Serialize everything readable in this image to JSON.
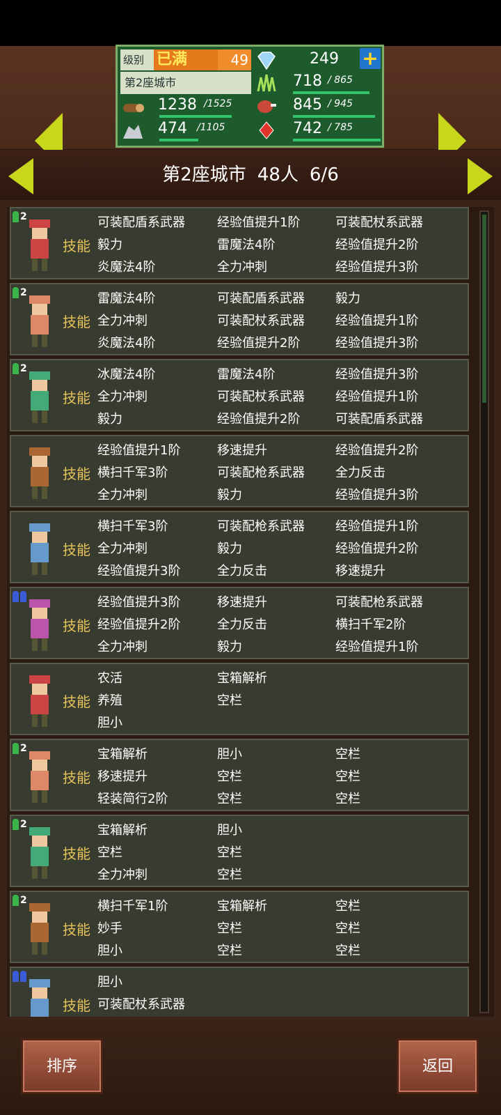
{
  "header": {
    "level_label": "级别",
    "level_max": "已满",
    "level_value": "49",
    "city": "第2座城市",
    "gems": "249",
    "resources": [
      {
        "name": "grass-icon",
        "value": "718",
        "max": "/ 865",
        "fill": 0.83
      },
      {
        "name": "wood-icon",
        "value": "1238",
        "max": "/1525",
        "fill": 0.81
      },
      {
        "name": "meat-icon",
        "value": "845",
        "max": "/ 945",
        "fill": 0.89
      },
      {
        "name": "ore-icon",
        "value": "474",
        "max": "/1105",
        "fill": 0.43
      },
      {
        "name": "ruby-icon",
        "value": "742",
        "max": "/ 785",
        "fill": 0.95
      }
    ]
  },
  "subheader": {
    "city": "第2座城市",
    "count": "48人",
    "ratio": "6/6"
  },
  "skill_label": "技能",
  "characters": [
    {
      "badge": "2",
      "team": "green",
      "skills": [
        "可装配盾系武器",
        "经验值提升1阶",
        "可装配杖系武器",
        "毅力",
        "雷魔法4阶",
        "经验值提升2阶",
        "炎魔法4阶",
        "全力冲刺",
        "经验值提升3阶"
      ]
    },
    {
      "badge": "2",
      "team": "green",
      "skills": [
        "雷魔法4阶",
        "可装配盾系武器",
        "毅力",
        "全力冲刺",
        "可装配杖系武器",
        "经验值提升1阶",
        "炎魔法4阶",
        "经验值提升2阶",
        "经验值提升3阶"
      ]
    },
    {
      "badge": "2",
      "team": "green",
      "skills": [
        "冰魔法4阶",
        "雷魔法4阶",
        "经验值提升3阶",
        "全力冲刺",
        "可装配杖系武器",
        "经验值提升1阶",
        "毅力",
        "经验值提升2阶",
        "可装配盾系武器"
      ]
    },
    {
      "badge": "",
      "team": "none",
      "skills": [
        "经验值提升1阶",
        "移速提升",
        "经验值提升2阶",
        "横扫千军3阶",
        "可装配枪系武器",
        "全力反击",
        "全力冲刺",
        "毅力",
        "经验值提升3阶"
      ]
    },
    {
      "badge": "",
      "team": "none",
      "skills": [
        "横扫千军3阶",
        "可装配枪系武器",
        "经验值提升1阶",
        "全力冲刺",
        "毅力",
        "经验值提升2阶",
        "经验值提升3阶",
        "全力反击",
        "移速提升"
      ]
    },
    {
      "badge": "",
      "team": "blue",
      "skills": [
        "经验值提升3阶",
        "移速提升",
        "可装配枪系武器",
        "经验值提升2阶",
        "全力反击",
        "横扫千军2阶",
        "全力冲刺",
        "毅力",
        "经验值提升1阶"
      ]
    },
    {
      "badge": "",
      "team": "none",
      "skills": [
        "农活",
        "宝箱解析",
        "",
        "养殖",
        "空栏",
        "",
        "胆小",
        "",
        ""
      ]
    },
    {
      "badge": "2",
      "team": "green",
      "skills": [
        "宝箱解析",
        "胆小",
        "空栏",
        "移速提升",
        "空栏",
        "空栏",
        "轻装简行2阶",
        "空栏",
        "空栏"
      ]
    },
    {
      "badge": "2",
      "team": "green",
      "skills": [
        "宝箱解析",
        "胆小",
        "",
        "空栏",
        "空栏",
        "",
        "全力冲刺",
        "空栏",
        ""
      ]
    },
    {
      "badge": "2",
      "team": "green",
      "skills": [
        "横扫千军1阶",
        "宝箱解析",
        "空栏",
        "妙手",
        "空栏",
        "空栏",
        "胆小",
        "空栏",
        "空栏"
      ]
    },
    {
      "badge": "",
      "team": "blue",
      "skills": [
        "胆小",
        "",
        "",
        "可装配杖系武器",
        "",
        "",
        "",
        "",
        ""
      ]
    }
  ],
  "buttons": {
    "sort": "排序",
    "back": "返回"
  }
}
